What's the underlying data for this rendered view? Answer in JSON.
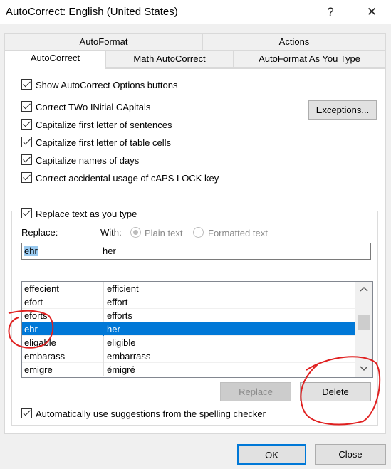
{
  "window": {
    "title": "AutoCorrect: English (United States)",
    "help": "?",
    "close": "✕"
  },
  "tabs_row1": [
    "AutoFormat",
    "Actions"
  ],
  "tabs_row2": [
    "AutoCorrect",
    "Math AutoCorrect",
    "AutoFormat As You Type"
  ],
  "options": {
    "show_buttons": "Show AutoCorrect Options buttons",
    "two_initial": "Correct TWo INitial CApitals",
    "first_sentence": "Capitalize first letter of sentences",
    "first_table": "Capitalize first letter of table cells",
    "names_days": "Capitalize names of days",
    "caps_lock": "Correct accidental usage of cAPS LOCK key",
    "replace_typing": "Replace text as you type",
    "suggestions": "Automatically use suggestions from the spelling checker"
  },
  "exceptions_label": "Exceptions...",
  "replace_label": "Replace:",
  "with_label": "With:",
  "plain_text": "Plain text",
  "formatted_text": "Formatted text",
  "replace_value": "ehr",
  "with_value": "her",
  "entries": [
    {
      "from": "effecient",
      "to": "efficient"
    },
    {
      "from": "efort",
      "to": "effort"
    },
    {
      "from": "eforts",
      "to": "efforts"
    },
    {
      "from": "ehr",
      "to": "her"
    },
    {
      "from": "eligable",
      "to": "eligible"
    },
    {
      "from": "embarass",
      "to": "embarrass"
    },
    {
      "from": "emigre",
      "to": "émigré"
    }
  ],
  "selected_index": 3,
  "replace_button": "Replace",
  "delete_button": "Delete",
  "ok_button": "OK",
  "close_button": "Close",
  "colors": {
    "selection": "#0078d7",
    "annotation": "#e02020"
  }
}
